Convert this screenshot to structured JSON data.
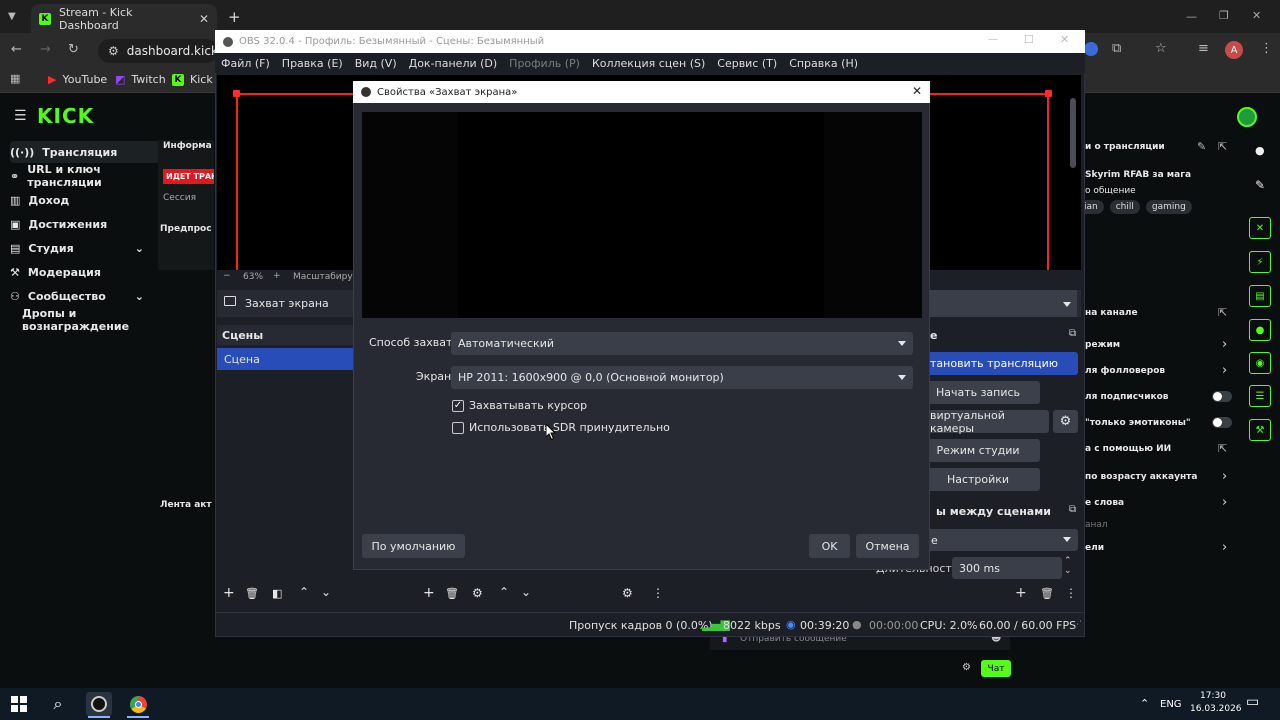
{
  "browser": {
    "tab_title": "Stream - Kick Dashboard",
    "new_tab": "+",
    "url": "dashboard.kick.co",
    "bookmarks": [
      "YouTube",
      "Twitch",
      "Kick"
    ],
    "avatar_letter": "A"
  },
  "kick": {
    "logo": "KICK",
    "sidebar": [
      {
        "label": "Трансляция"
      },
      {
        "label": "URL и ключ трансляции"
      },
      {
        "label": "Доход"
      },
      {
        "label": "Достижения"
      },
      {
        "label": "Студия"
      },
      {
        "label": "Модерация"
      },
      {
        "label": "Сообщество"
      },
      {
        "label": "Дропы и вознаграждение"
      }
    ],
    "info_label": "Информа",
    "live_badge": "ИДЕТ ТРАНСЛ",
    "session_label": "Сессия",
    "preview_label": "Предпрос",
    "activity_label": "Лента акт",
    "right": {
      "stream_info": "и о трансляции",
      "stream_title": "Skyrim RFAB за мага",
      "category": "о общение",
      "tags": [
        "ian",
        "chill",
        "gaming"
      ],
      "on_channel": "на канале",
      "mode": "режим",
      "followers": "ля фолловеров",
      "subscribers": "ля подписчиков",
      "emotes_only": "\"только эмотиконы\"",
      "ai": "а с помощью ИИ",
      "account_age": "по возрасту аккаунта",
      "words": "е слова",
      "channel": "анал",
      "goals": "ели"
    },
    "chat_placeholder": "Отправить сообщение",
    "chat_button": "Чат"
  },
  "obs": {
    "title": "OBS 32.0.4 - Профиль: Безымянный - Сцены: Безымянный",
    "menu": [
      {
        "label": "Файл (F)",
        "disabled": false
      },
      {
        "label": "Правка (E)",
        "disabled": false
      },
      {
        "label": "Вид (V)",
        "disabled": false
      },
      {
        "label": "Док-панели (D)",
        "disabled": false
      },
      {
        "label": "Профиль (P)",
        "disabled": true
      },
      {
        "label": "Коллекция сцен (S)",
        "disabled": false
      },
      {
        "label": "Сервис (T)",
        "disabled": false
      },
      {
        "label": "Справка (H)",
        "disabled": false
      }
    ],
    "zoom": "63%",
    "zoom_minus": "−",
    "zoom_plus": "+",
    "scaling_label": "Масштабируе",
    "source_selected": "Захват экрана",
    "scenes_title": "Сцены",
    "scene_item": "Сцена",
    "controls": {
      "stop_stream": "тановить трансляцию",
      "start_record": "Начать запись",
      "virtual_cam": "виртуальной камеры",
      "studio_mode": "Режим студии",
      "settings": "Настройки",
      "controls_title": "е"
    },
    "transitions": {
      "title": "ы между сценами",
      "selected": "е",
      "duration_label": "Длительность",
      "duration": "300 ms"
    },
    "status": {
      "dropped": "Пропуск кадров 0 (0.0%)",
      "bitrate": "8022 kbps",
      "stream_time": "00:39:20",
      "record_time": "00:00:00",
      "cpu": "CPU: 2.0%",
      "fps": "60.00 / 60.00 FPS"
    }
  },
  "dialog": {
    "title": "Свойства «Захват экрана»",
    "method_label": "Способ захвата",
    "method_value": "Автоматический",
    "screen_label": "Экран",
    "screen_value": "HP 2011: 1600x900 @ 0,0 (Основной монитор)",
    "capture_cursor": "Захватывать курсор",
    "capture_cursor_checked": true,
    "force_sdr": "Использовать SDR принудительно",
    "force_sdr_checked": false,
    "defaults_button": "По умолчанию",
    "ok_button": "OK",
    "cancel_button": "Отмена"
  },
  "taskbar": {
    "lang": "ENG",
    "time": "17:30",
    "date": "16.03.2026"
  },
  "colors": {
    "kick_green": "#53fc18",
    "obs_blue": "#284cb8",
    "live_red": "#e3171f"
  }
}
